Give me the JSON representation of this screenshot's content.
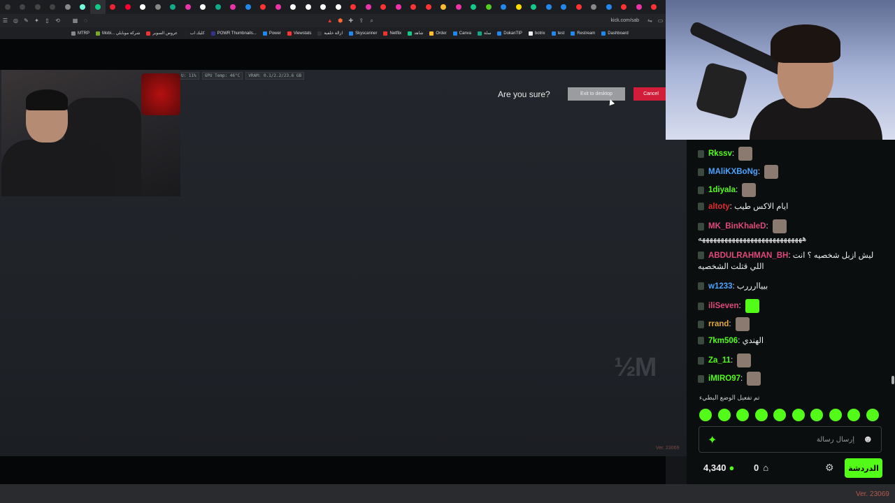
{
  "browser": {
    "tab_colors": [
      "#444",
      "#444",
      "#444",
      "#444",
      "#888",
      "#7fd",
      "#1c8",
      "#e23",
      "#f03",
      "#fff",
      "#888",
      "#1a8",
      "#e3a",
      "#fff",
      "#1a8",
      "#e3a",
      "#28e",
      "#f33",
      "#e3a",
      "#fff",
      "#fff",
      "#fff",
      "#fff",
      "#f33",
      "#e3a",
      "#f33",
      "#e3a",
      "#f33",
      "#f33",
      "#fb3",
      "#e3a",
      "#1c8",
      "#5c2",
      "#28e",
      "#fd0",
      "#1c8",
      "#28e",
      "#28e",
      "#f33",
      "#888",
      "#28e",
      "#f33",
      "#e3a",
      "#f33"
    ],
    "address": "kick.com/sab",
    "bookmarks": [
      {
        "label": "MTRP",
        "color": "#888"
      },
      {
        "label": "Mobi... شركة موبايلي",
        "color": "#7a2"
      },
      {
        "label": "عروض السوبر",
        "color": "#e33"
      },
      {
        "label": "كليك اب",
        "color": "#222"
      },
      {
        "label": "POWR Thumbnails...",
        "color": "#338"
      },
      {
        "label": "Power",
        "color": "#28e"
      },
      {
        "label": "Viewstats",
        "color": "#f33"
      },
      {
        "label": "ازالة خلفية",
        "color": "#333"
      },
      {
        "label": "Skyscanner",
        "color": "#28e"
      },
      {
        "label": "Netflix",
        "color": "#e33"
      },
      {
        "label": "شاهد",
        "color": "#1c8"
      },
      {
        "label": "Order",
        "color": "#fb3"
      },
      {
        "label": "Canva",
        "color": "#28e"
      },
      {
        "label": "سلة",
        "color": "#1a8"
      },
      {
        "label": "DokanTIP",
        "color": "#28e"
      },
      {
        "label": "botrix",
        "color": "#eee"
      },
      {
        "label": "test",
        "color": "#28e"
      },
      {
        "label": "Restream",
        "color": "#28e"
      },
      {
        "label": "Dashboard",
        "color": "#28e"
      }
    ]
  },
  "game": {
    "hud": [
      "U: 11%",
      "GPU Temp: 46°C",
      "VRAM: 0.1/2.2/23.6 GB"
    ],
    "prompt": "Are you sure?",
    "exit_label": "Exit to desktop",
    "cancel_label": "Cancel",
    "watermark": "½M",
    "version": "Ver. 23069"
  },
  "overlay_version": "Ver. 23069",
  "chat": {
    "messages": [
      {
        "user": "Rkssv",
        "color": "#53fc18",
        "text": ""
      },
      {
        "user": "MAliKXBoNg",
        "color": "#4aa3ff",
        "text": ""
      },
      {
        "user": "1diyala",
        "color": "#53fc18",
        "text": ""
      },
      {
        "user": "altoty",
        "color": "#e02c2c",
        "text": "ايام الاكس طيب"
      },
      {
        "user": "MK_BinKhaleD",
        "color": "#e0497a",
        "text": ""
      },
      {
        "user": "",
        "color": "#eee",
        "text": "ههههههههههههههههههههههههههههه"
      },
      {
        "user": "ABDULRAHMAN_BH",
        "color": "#e0497a",
        "text": "ليش ازبل شخصيه ؟ انت اللي قتلت الشخصيه"
      },
      {
        "user": "w1233",
        "color": "#4aa3ff",
        "text": "بيياارررب"
      },
      {
        "user": "iliSeven",
        "color": "#e0497a",
        "text": ""
      },
      {
        "user": "rrand",
        "color": "#e0a83a",
        "text": ""
      },
      {
        "user": "7km506",
        "color": "#53fc18",
        "text": "الهندي"
      },
      {
        "user": "Za_11",
        "color": "#53fc18",
        "text": ""
      },
      {
        "user": "iMIRO97",
        "color": "#53fc18",
        "text": ""
      }
    ],
    "slow_mode": "تم تفعيل الوضع البطيء",
    "input_placeholder": "إرسال رسالة",
    "points": "4,340",
    "gifts": "0",
    "chat_button": "الدردشة"
  }
}
